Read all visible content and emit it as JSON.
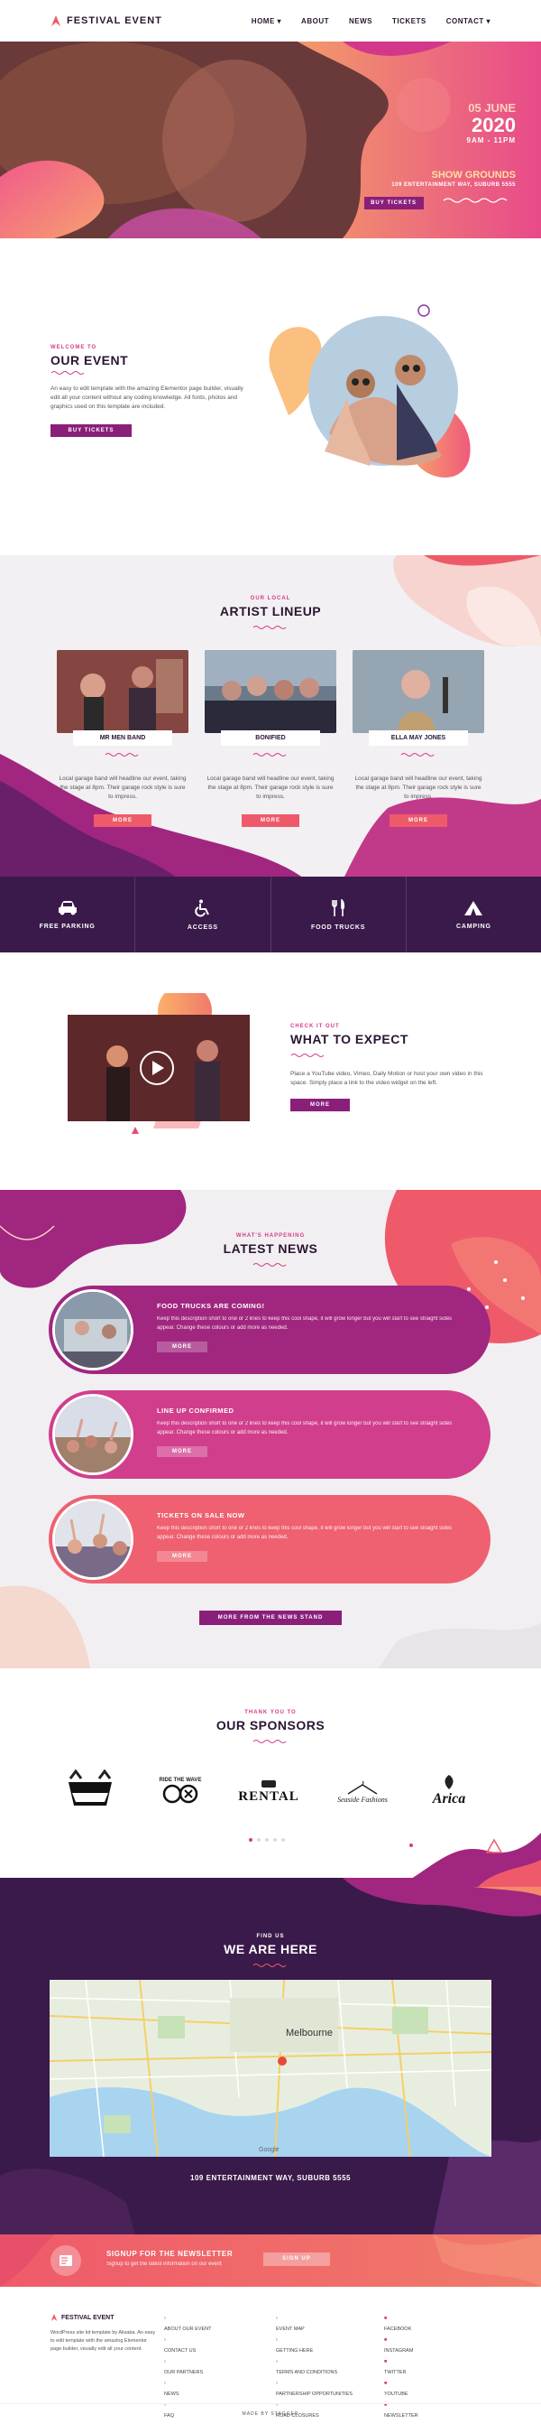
{
  "header": {
    "logo_text": "FESTIVAL EVENT",
    "nav": [
      "HOME",
      "ABOUT",
      "NEWS",
      "TICKETS",
      "CONTACT"
    ]
  },
  "hero": {
    "date": "05 JUNE",
    "year": "2020",
    "time": "9AM - 11PM",
    "venue": "SHOW GROUNDS",
    "address": "109 ENTERTAINMENT WAY, SUBURB 5555",
    "cta": "BUY TICKETS"
  },
  "about": {
    "eyebrow": "WELCOME TO",
    "title": "OUR EVENT",
    "text": "An easy to edit template with the amazing Elementor page builder, visually edit all your content without any coding knowledge. All fonts, photos and graphics used on this template are included.",
    "cta": "BUY TICKETS"
  },
  "lineup": {
    "eyebrow": "OUR LOCAL",
    "title": "ARTIST LINEUP",
    "artists": [
      {
        "name": "MR MEN BAND",
        "text": "Local garage band will headline our event, taking the stage at 8pm.  Their garage rock style is sure to impress.",
        "cta": "MORE"
      },
      {
        "name": "BONIFIED",
        "text": "Local garage band will headline our event, taking the stage at 8pm.  Their garage rock style is sure to impress.",
        "cta": "MORE"
      },
      {
        "name": "ELLA MAY JONES",
        "text": "Local garage band will headline our event, taking the stage at 8pm.  Their garage rock style is sure to impress.",
        "cta": "MORE"
      }
    ]
  },
  "features": [
    {
      "label": "FREE PARKING",
      "icon": "car-icon"
    },
    {
      "label": "ACCESS",
      "icon": "wheelchair-icon"
    },
    {
      "label": "FOOD TRUCKS",
      "icon": "fork-knife-icon"
    },
    {
      "label": "CAMPING",
      "icon": "tent-icon"
    }
  ],
  "expect": {
    "eyebrow": "CHECK IT OUT",
    "title": "WHAT TO EXPECT",
    "text": "Place a YouTube video, Vimeo, Daily Motion or host your own video in this space.  Simply place a link to the video widget on the left.",
    "cta": "MORE"
  },
  "news": {
    "eyebrow": "WHAT'S HAPPENING",
    "title": "LATEST NEWS",
    "items": [
      {
        "title": "FOOD TRUCKS ARE COMING!",
        "text": "Keep this description short to one or 2 lines to keep this cool shape, it will grow longer but you will start to see straight sides appear. Change these colours or add more as needed.",
        "cta": "MORE",
        "color": "#a1267f"
      },
      {
        "title": "LINE UP CONFIRMED",
        "text": "Keep this description short to one or 2 lines to keep this cool shape, it will grow longer but you will start to see straight sides appear. Change these colours or add more as needed.",
        "cta": "MORE",
        "color": "#d13f8c"
      },
      {
        "title": "TICKETS ON SALE NOW",
        "text": "Keep this description short to one or 2 lines to keep this cool shape, it will grow longer but you will start to see straight sides appear. Change these colours or add more as needed.",
        "cta": "MORE",
        "color": "#ef6070"
      }
    ],
    "cta": "MORE FROM THE NEWS STAND"
  },
  "sponsors": {
    "eyebrow": "THANK YOU TO",
    "title": "OUR SPONSORS",
    "logos": [
      {
        "name": "sponsor-logo-1"
      },
      {
        "name": "sponsor-logo-2",
        "text": "RIDE THE WAVE"
      },
      {
        "name": "sponsor-logo-3",
        "text": "RENTAL"
      },
      {
        "name": "sponsor-logo-4",
        "text": "Seaside Fashions"
      },
      {
        "name": "sponsor-logo-5",
        "text": "Arica"
      }
    ]
  },
  "location": {
    "eyebrow": "FIND US",
    "title": "WE ARE HERE",
    "city": "Melbourne",
    "address": "109 ENTERTAINMENT WAY, SUBURB 5555"
  },
  "newsletter": {
    "title": "SIGNUP FOR THE NEWSLETTER",
    "subtitle": "Signup to get the latest information on our event",
    "cta": "SIGN UP"
  },
  "footer": {
    "brand": "FESTIVAL EVENT",
    "about": "WordPress site kit template by Alisaba. An easy to edit template with the amazing Elementor page builder, visually edit all your content.",
    "col1": [
      "ABOUT OUR EVENT",
      "CONTACT US",
      "OUR PARTNERS",
      "NEWS",
      "FAQ"
    ],
    "col2": [
      "EVENT MAP",
      "GETTING HERE",
      "TERMS AND CONDITIONS",
      "PARTNERSHIP OPPORTUNITIES",
      "ROAD CLOSURES"
    ],
    "col3": [
      "FACEBOOK",
      "INSTAGRAM",
      "TWITTER",
      "YOUTUBE",
      "NEWSLETTER"
    ],
    "made_by": "MADE BY STAGGER"
  }
}
